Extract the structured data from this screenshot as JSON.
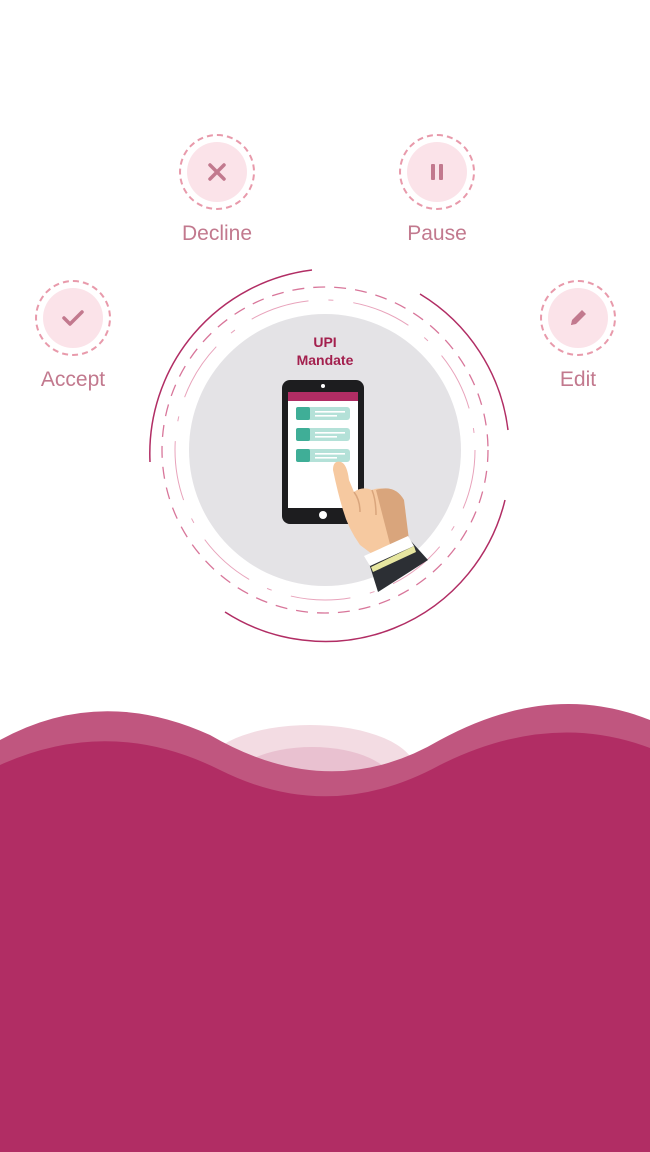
{
  "actions": {
    "decline": {
      "label": "Decline",
      "icon": "close-icon"
    },
    "pause": {
      "label": "Pause",
      "icon": "pause-icon"
    },
    "accept": {
      "label": "Accept",
      "icon": "check-icon"
    },
    "edit": {
      "label": "Edit",
      "icon": "pencil-icon"
    }
  },
  "hero": {
    "title_line1": "UPI",
    "title_line2": "Mandate"
  },
  "colors": {
    "brand": "#b12d64",
    "accent_light": "#fbe3e9",
    "icon": "#c2798e",
    "list_item": "#3fae97"
  }
}
